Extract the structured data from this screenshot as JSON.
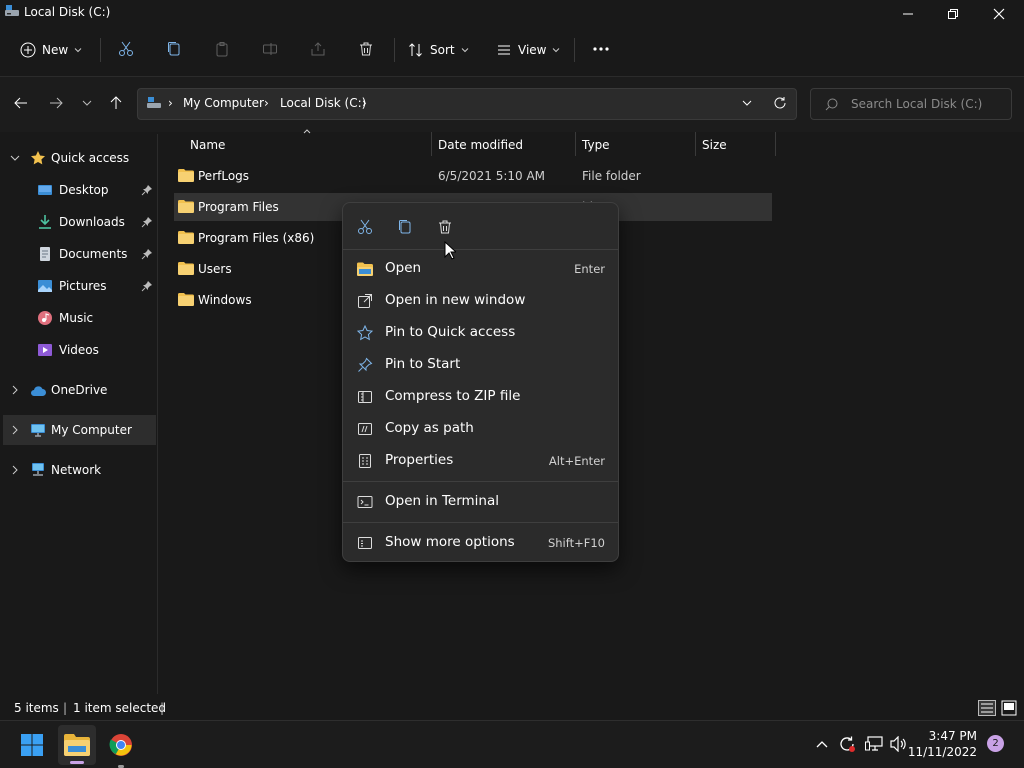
{
  "window": {
    "title": "Local Disk (C:)"
  },
  "commandbar": {
    "new_label": "New",
    "sort_label": "Sort",
    "view_label": "View"
  },
  "address": {
    "crumbs": [
      "My Computer",
      "Local Disk (C:)"
    ],
    "search_placeholder": "Search Local Disk (C:)"
  },
  "sidebar": {
    "quick_access": "Quick access",
    "items": [
      {
        "label": "Desktop",
        "icon": "desktop-icon",
        "pinned": true
      },
      {
        "label": "Downloads",
        "icon": "downloads-icon",
        "pinned": true
      },
      {
        "label": "Documents",
        "icon": "documents-icon",
        "pinned": true
      },
      {
        "label": "Pictures",
        "icon": "pictures-icon",
        "pinned": true
      },
      {
        "label": "Music",
        "icon": "music-icon",
        "pinned": false
      },
      {
        "label": "Videos",
        "icon": "videos-icon",
        "pinned": false
      }
    ],
    "onedrive": "OneDrive",
    "my_computer": "My Computer",
    "network": "Network"
  },
  "columns": {
    "name": "Name",
    "date": "Date modified",
    "type": "Type",
    "size": "Size"
  },
  "files": [
    {
      "name": "PerfLogs",
      "date": "6/5/2021 5:10 AM",
      "type": "File folder"
    },
    {
      "name": "Program Files",
      "date": "",
      "type": "lder"
    },
    {
      "name": "Program Files (x86)",
      "date": "",
      "type": "lder"
    },
    {
      "name": "Users",
      "date": "",
      "type": "lder"
    },
    {
      "name": "Windows",
      "date": "",
      "type": "lder"
    }
  ],
  "context_menu": {
    "items": [
      {
        "label": "Open",
        "shortcut": "Enter",
        "icon": "folder-open-icon"
      },
      {
        "label": "Open in new window",
        "shortcut": "",
        "icon": "open-new-window-icon"
      },
      {
        "label": "Pin to Quick access",
        "shortcut": "",
        "icon": "star-icon"
      },
      {
        "label": "Pin to Start",
        "shortcut": "",
        "icon": "pin-icon"
      },
      {
        "label": "Compress to ZIP file",
        "shortcut": "",
        "icon": "zip-icon"
      },
      {
        "label": "Copy as path",
        "shortcut": "",
        "icon": "copy-path-icon"
      },
      {
        "label": "Properties",
        "shortcut": "Alt+Enter",
        "icon": "properties-icon"
      }
    ],
    "terminal": {
      "label": "Open in Terminal",
      "icon": "terminal-icon"
    },
    "more": {
      "label": "Show more options",
      "shortcut": "Shift+F10",
      "icon": "more-options-icon"
    }
  },
  "status": {
    "items_count": "5 items",
    "selected": "1 item selected"
  },
  "taskbar": {
    "time": "3:47 PM",
    "date": "11/11/2022",
    "notification_count": "2"
  },
  "colors": {
    "accent": "#0078d4",
    "folder": "#f2c14e",
    "background": "#191919",
    "menu_bg": "#2b2b2b"
  }
}
